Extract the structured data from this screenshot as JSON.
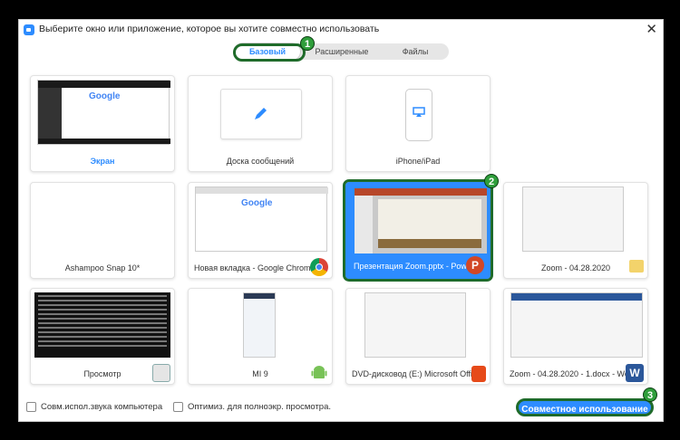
{
  "window": {
    "title": "Выберите окно или приложение, которое вы хотите совместно использовать",
    "close_icon": "close-icon"
  },
  "tabs": {
    "basic": "Базовый",
    "advanced": "Расширенные",
    "files": "Файлы"
  },
  "badges": [
    "1",
    "2",
    "3"
  ],
  "tiles": [
    {
      "label": "Экран",
      "selected": false
    },
    {
      "label": "Доска сообщений",
      "selected": false
    },
    {
      "label": "iPhone/iPad",
      "selected": false
    },
    {
      "label": "Ashampoo Snap 10*",
      "selected": false
    },
    {
      "label": "Новая вкладка - Google Chrome",
      "selected": false
    },
    {
      "label": "Презентация Zoom.pptx - Power...",
      "selected": true
    },
    {
      "label": "Zoom - 04.28.2020",
      "selected": false
    },
    {
      "label": "Просмотр",
      "selected": false
    },
    {
      "label": "MI 9",
      "selected": false
    },
    {
      "label": "DVD-дисковод (E:) Microsoft Offi...",
      "selected": false
    },
    {
      "label": "Zoom - 04.28.2020 - 1.docx - Word",
      "selected": false
    }
  ],
  "footer": {
    "share_audio": "Совм.испол.звука компьютера",
    "optimize": "Оптимиз. для полноэкр. просмотра.",
    "share_button": "Совместное использование"
  },
  "colors": {
    "accent": "#2d8cff",
    "highlight": "#1f6b2a"
  }
}
